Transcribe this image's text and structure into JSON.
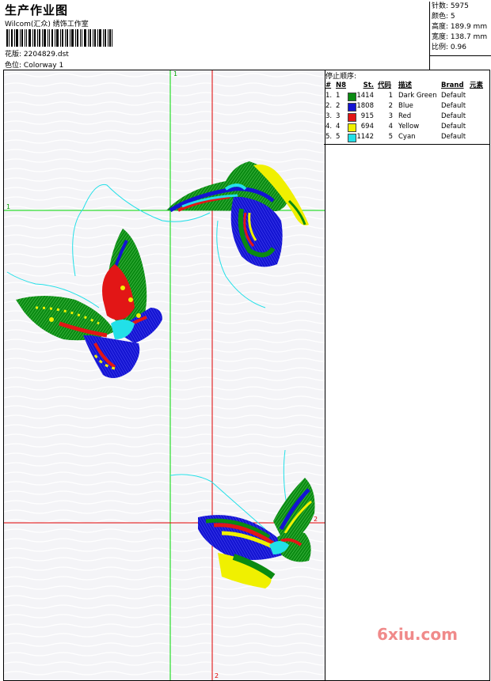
{
  "header": {
    "title": "生产作业图",
    "subtitle": "Wilcom(汇众) 绣饰工作室",
    "file_label": "花版:",
    "file_name": "2204829.dst",
    "colorway_label": "色位:",
    "colorway_name": "Colorway 1"
  },
  "stats": {
    "stitches_label": "针数:",
    "stitches_value": "5975",
    "colors_label": "颜色:",
    "colors_value": "5",
    "height_label": "高度:",
    "height_value": "189.9 mm",
    "width_label": "宽度:",
    "width_value": "138.7 mm",
    "scale_label": "比例:",
    "scale_value": "0.96"
  },
  "panel": {
    "title": "停止顺序:",
    "headers": {
      "hash": "#",
      "n": "N8",
      "st": "St.",
      "code": "代码",
      "desc": "描述",
      "brand": "Brand",
      "element": "元素"
    },
    "rows": [
      {
        "num": "1.",
        "n": "1",
        "color": "#0a8a12",
        "st": "1414",
        "code": "1",
        "desc": "Dark Green",
        "brand": "Default"
      },
      {
        "num": "2.",
        "n": "2",
        "color": "#1414d2",
        "st": "1808",
        "code": "2",
        "desc": "Blue",
        "brand": "Default"
      },
      {
        "num": "3.",
        "n": "3",
        "color": "#e21616",
        "st": "915",
        "code": "3",
        "desc": "Red",
        "brand": "Default"
      },
      {
        "num": "4.",
        "n": "4",
        "color": "#f0f000",
        "st": "694",
        "code": "4",
        "desc": "Yellow",
        "brand": "Default"
      },
      {
        "num": "5.",
        "n": "5",
        "color": "#22e0e8",
        "st": "1142",
        "code": "5",
        "desc": "Cyan",
        "brand": "Default"
      }
    ]
  },
  "guides": {
    "green_label": "1",
    "red_label": "2"
  },
  "watermark": "6xiu.com",
  "colors": {
    "green": "#0a8a12",
    "blue": "#1414d2",
    "red": "#e21616",
    "yellow": "#f0f000",
    "cyan": "#22e0e8",
    "guide_green": "#00d800",
    "guide_red": "#e00000"
  }
}
